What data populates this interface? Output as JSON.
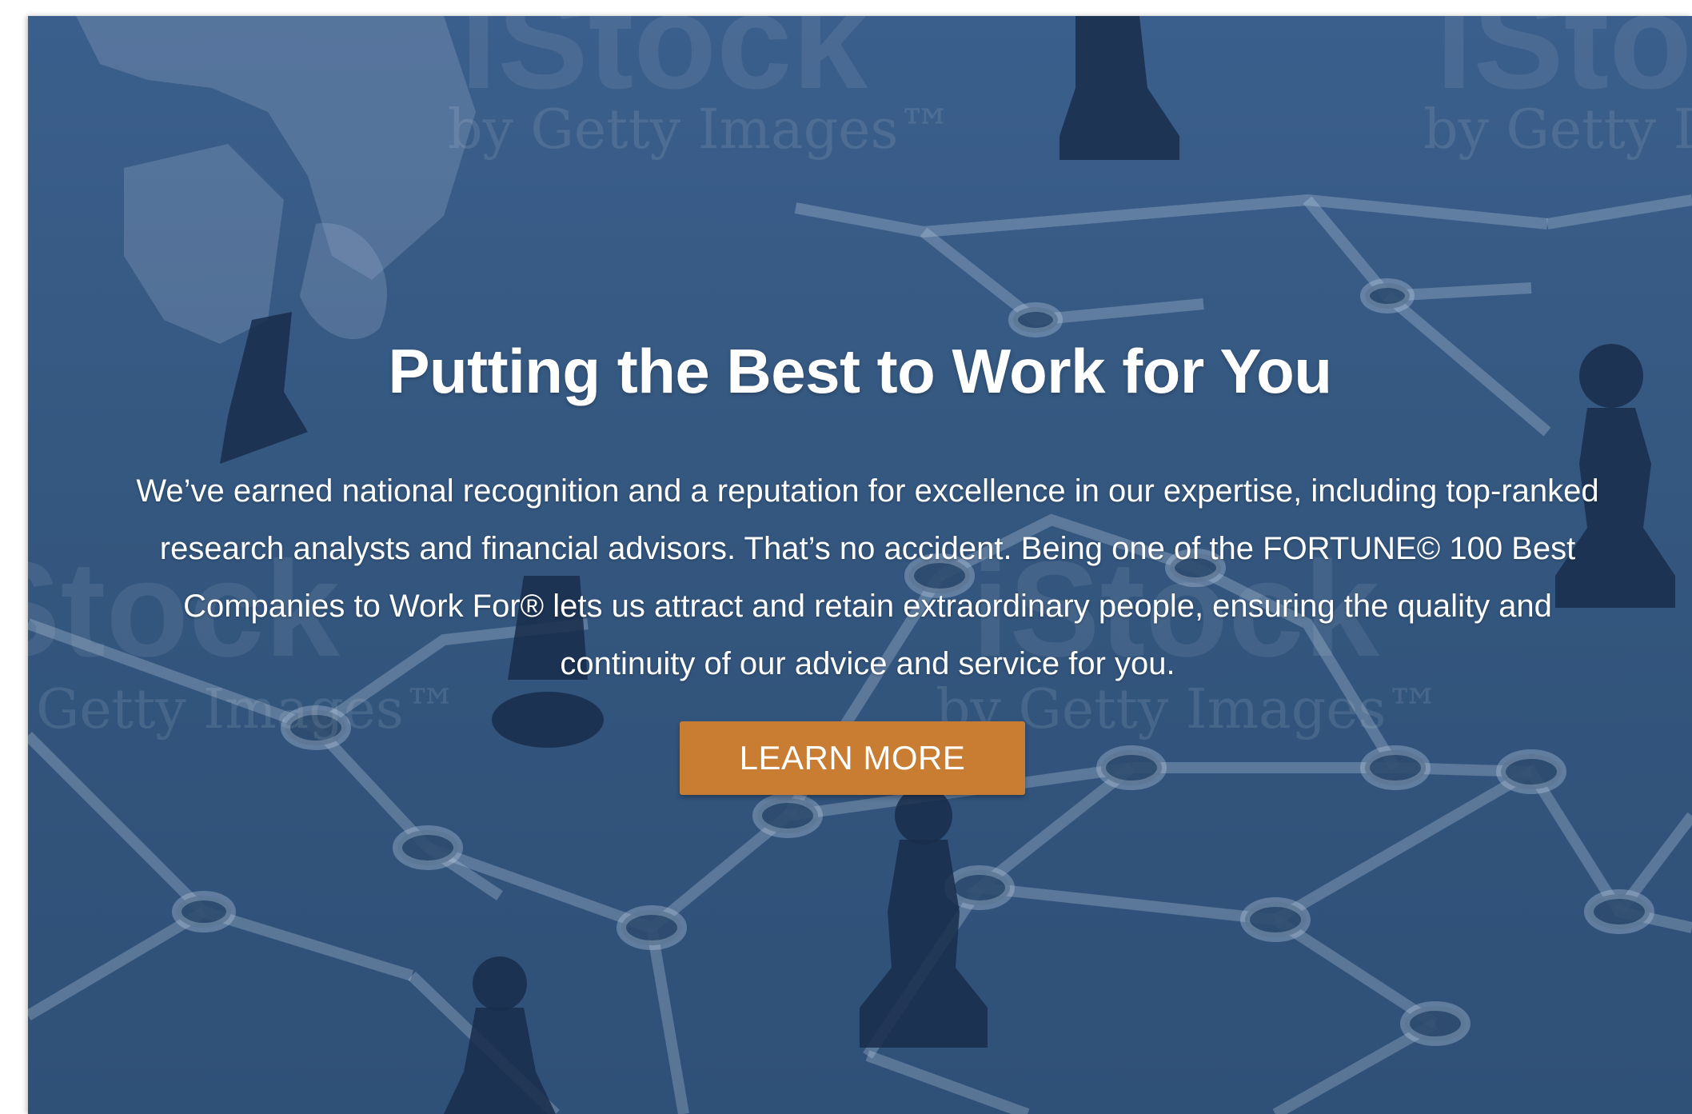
{
  "hero": {
    "title": "Putting the Best to Work for You",
    "body": "We’ve earned national recognition and a reputation for excellence in our expertise, including top-ranked research analysts and financial advisors. That’s no accident. Being one of the FORTUNE© 100 Best Companies to Work For® lets us attract and retain extraordinary people, ensuring the quality and continuity of our advice and service for you.",
    "cta_label": "LEARN MORE"
  },
  "watermark": {
    "brand": "iStock",
    "byline": "by Getty Images™"
  },
  "colors": {
    "overlay": "#34577f",
    "button": "#c97d32",
    "text": "#ffffff"
  }
}
